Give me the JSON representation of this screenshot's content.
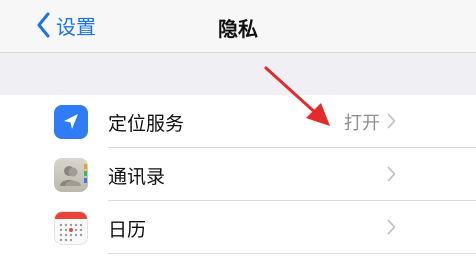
{
  "navbar": {
    "back_label": "设置",
    "back_icon": "chevron-left-icon",
    "title": "隐私"
  },
  "items": [
    {
      "label": "定位服务",
      "value": "打开",
      "icon": "location-arrow-icon"
    },
    {
      "label": "通讯录",
      "value": "",
      "icon": "contacts-icon"
    },
    {
      "label": "日历",
      "value": "",
      "icon": "calendar-icon"
    }
  ],
  "colors": {
    "accent": "#1a73e8",
    "location_icon": "#2f7cf6",
    "annotation_arrow": "#e32b2b",
    "group_background": "#efeff4"
  }
}
